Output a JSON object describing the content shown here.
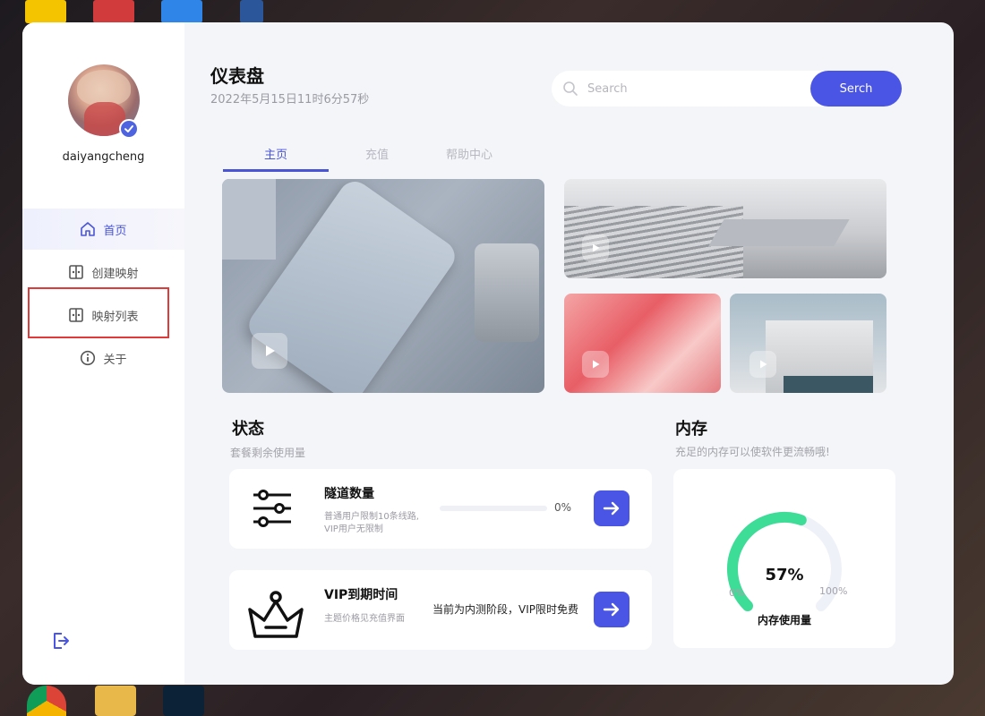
{
  "sidebar": {
    "username": "daiyangcheng",
    "items": [
      {
        "label": "首页",
        "icon": "home-icon"
      },
      {
        "label": "创建映射",
        "icon": "mapping-icon"
      },
      {
        "label": "映射列表",
        "icon": "mapping-icon"
      },
      {
        "label": "关于",
        "icon": "info-icon"
      }
    ]
  },
  "header": {
    "title": "仪表盘",
    "datetime": "2022年5月15日11时6分57秒"
  },
  "search": {
    "placeholder": "Search",
    "button_label": "Serch"
  },
  "tabs": [
    {
      "label": "主页"
    },
    {
      "label": "充值"
    },
    {
      "label": "帮助中心"
    }
  ],
  "status": {
    "title": "状态",
    "subtitle": "套餐剩余使用量",
    "tunnel": {
      "title": "隧道数量",
      "desc_line1": "普通用户限制10条线路,",
      "desc_line2": "VIP用户无限制",
      "progress": 0,
      "progress_label": "0%"
    },
    "vip": {
      "title": "VIP到期时间",
      "desc": "主题价格见充值界面",
      "value": "当前为内测阶段，VIP限时免费"
    }
  },
  "memory": {
    "title": "内存",
    "subtitle": "充足的内存可以使软件更流畅哦!",
    "percent": 57,
    "percent_label": "57%",
    "min_label": "0%",
    "max_label": "100%",
    "caption": "内存使用量"
  },
  "colors": {
    "accent": "#4a55e5",
    "gauge": "#3ddc97",
    "gauge_track": "#eef1f8"
  }
}
